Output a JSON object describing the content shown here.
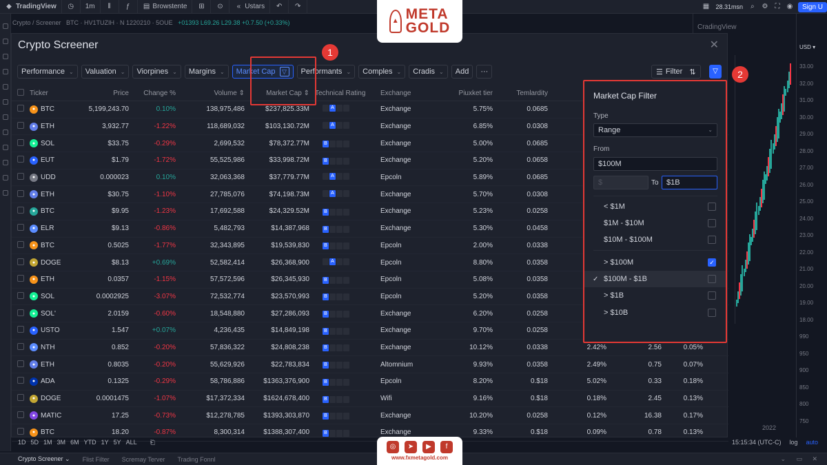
{
  "topbar": {
    "brand": "TradingView",
    "interval": "1m",
    "layout": "Browstente",
    "alerts": "Ustars",
    "price": "28.31msn",
    "signup": "Sign U"
  },
  "breadcrumb": {
    "path": "Crypto / Screener",
    "symbol": "BTC · HV1TUZIH · N 1220210 · 5OUE",
    "quote": "+01393 L69.26 L29.38 +0.7.50 (+0.33%)"
  },
  "modal": {
    "title": "Crypto Screener",
    "filter_tabs": [
      "Performance",
      "Valuation",
      "Viorpines",
      "Margins"
    ],
    "active_filter": "Market Cap",
    "more_tabs": [
      "Performants",
      "Comples",
      "Cradis"
    ],
    "add_label": "Add",
    "more_label": "···",
    "filter_label": "Filter"
  },
  "table": {
    "columns": [
      "Ticker",
      "Price",
      "Change %",
      "Volume ⇕",
      "Market Cap ⇕",
      "Technical Rating",
      "Exchange",
      "Piuxket tier",
      "Temlardity",
      "Bierleaf",
      "",
      ""
    ],
    "rows": [
      {
        "ticker": "BTC",
        "price": "5,199,243.70",
        "change": "0.10%",
        "dir": "pos",
        "volume": "138,975,486",
        "mcap": "$237,825.33M",
        "rating": "A",
        "exchange": "Exchange",
        "tier": "5.75%",
        "tem": "0.0685",
        "b1": "",
        "b2": "",
        "b3": "",
        "color": "#f7931a"
      },
      {
        "ticker": "ETH",
        "price": "3,932.77",
        "change": "-1.22%",
        "dir": "neg",
        "volume": "118,689,032",
        "mcap": "$103,130.72M",
        "rating": "A",
        "exchange": "Exchange",
        "tier": "6.85%",
        "tem": "0.0308",
        "b1": "",
        "b2": "",
        "b3": "",
        "color": "#627eea"
      },
      {
        "ticker": "SOL",
        "price": "$33.75",
        "change": "-0.29%",
        "dir": "neg",
        "volume": "2,699,532",
        "mcap": "$78,372.77M",
        "rating": "B",
        "exchange": "Exchange",
        "tier": "5.00%",
        "tem": "0.0685",
        "b1": "",
        "b2": "",
        "b3": "",
        "color": "#14f195"
      },
      {
        "ticker": "EUT",
        "price": "$1.79",
        "change": "-1.72%",
        "dir": "neg",
        "volume": "55,525,986",
        "mcap": "$33,998.72M",
        "rating": "B",
        "exchange": "Exchange",
        "tier": "5.20%",
        "tem": "0.0658",
        "b1": "",
        "b2": "",
        "b3": "",
        "color": "#2962ff"
      },
      {
        "ticker": "UDD",
        "price": "0.000023",
        "change": "0.10%",
        "dir": "pos",
        "volume": "32,063,368",
        "mcap": "$37,779.77M",
        "rating": "A",
        "exchange": "Epcoln",
        "tier": "5.89%",
        "tem": "0.0685",
        "b1": "",
        "b2": "",
        "b3": "",
        "color": "#787b86"
      },
      {
        "ticker": "ETH",
        "price": "$30.75",
        "change": "-1.10%",
        "dir": "neg",
        "volume": "27,785,076",
        "mcap": "$74,198.73M",
        "rating": "A",
        "exchange": "Exchange",
        "tier": "5.70%",
        "tem": "0.0308",
        "b1": "",
        "b2": "",
        "b3": "",
        "color": "#627eea"
      },
      {
        "ticker": "BTC",
        "price": "$9.95",
        "change": "-1.23%",
        "dir": "neg",
        "volume": "17,692,588",
        "mcap": "$24,329.52M",
        "rating": "B",
        "exchange": "Exchange",
        "tier": "5.23%",
        "tem": "0.0258",
        "b1": "",
        "b2": "",
        "b3": "",
        "color": "#26a69a"
      },
      {
        "ticker": "ELR",
        "price": "$9.13",
        "change": "-0.86%",
        "dir": "neg",
        "volume": "5,482,793",
        "mcap": "$14,387,968",
        "rating": "B",
        "exchange": "Exchange",
        "tier": "5.30%",
        "tem": "0.0458",
        "b1": "",
        "b2": "",
        "b3": "",
        "color": "#5b8cff"
      },
      {
        "ticker": "BTC",
        "price": "0.5025",
        "change": "-1.77%",
        "dir": "neg",
        "volume": "32,343,895",
        "mcap": "$19,539,830",
        "rating": "B",
        "exchange": "Epcoln",
        "tier": "2.00%",
        "tem": "0.0338",
        "b1": "",
        "b2": "",
        "b3": "",
        "color": "#f7931a"
      },
      {
        "ticker": "DOGE",
        "price": "$8.13",
        "change": "+0.69%",
        "dir": "pos",
        "volume": "52,582,414",
        "mcap": "$26,368,900",
        "rating": "A",
        "exchange": "Epcoln",
        "tier": "8.80%",
        "tem": "0.0358",
        "b1": "",
        "b2": "",
        "b3": "",
        "color": "#c2a633"
      },
      {
        "ticker": "ETH",
        "price": "0.0357",
        "change": "-1.15%",
        "dir": "neg",
        "volume": "57,572,596",
        "mcap": "$26,345,930",
        "rating": "B",
        "exchange": "Epcoln",
        "tier": "5.08%",
        "tem": "0.0358",
        "b1": "",
        "b2": "",
        "b3": "",
        "color": "#f7931a"
      },
      {
        "ticker": "SOL",
        "price": "0.0002925",
        "change": "-3.07%",
        "dir": "neg",
        "volume": "72,532,774",
        "mcap": "$23,570,993",
        "rating": "B",
        "exchange": "Epcoln",
        "tier": "5.20%",
        "tem": "0.0358",
        "b1": "",
        "b2": "",
        "b3": "",
        "color": "#14f195"
      },
      {
        "ticker": "SOL'",
        "price": "2.0159",
        "change": "-0.60%",
        "dir": "neg",
        "volume": "18,548,880",
        "mcap": "$27,286,093",
        "rating": "B",
        "exchange": "Exchange",
        "tier": "6.20%",
        "tem": "0.0258",
        "b1": "",
        "b2": "",
        "b3": "",
        "color": "#14f195"
      },
      {
        "ticker": "USTO",
        "price": "1.547",
        "change": "+0.07%",
        "dir": "pos",
        "volume": "4,236,435",
        "mcap": "$14,849,198",
        "rating": "B",
        "exchange": "Exchange",
        "tier": "9.70%",
        "tem": "0.0258",
        "b1": "",
        "b2": "",
        "b3": "",
        "color": "#2962ff"
      },
      {
        "ticker": "NTH",
        "price": "0.852",
        "change": "-0.20%",
        "dir": "neg",
        "volume": "57,836,322",
        "mcap": "$24,808,238",
        "rating": "B",
        "exchange": "Exchange",
        "tier": "10.12%",
        "tem": "0.0338",
        "b1": "2.42%",
        "b2": "2.56",
        "b3": "0.05%",
        "color": "#5b8cff"
      },
      {
        "ticker": "ETH",
        "price": "0.8035",
        "change": "-0.20%",
        "dir": "neg",
        "volume": "55,629,926",
        "mcap": "$22,783,834",
        "rating": "B",
        "exchange": "Altomnium",
        "tier": "9.93%",
        "tem": "0.0358",
        "b1": "2.49%",
        "b2": "0.75",
        "b3": "0.07%",
        "color": "#627eea"
      },
      {
        "ticker": "ADA",
        "price": "0.1325",
        "change": "-0.29%",
        "dir": "neg",
        "volume": "58,786,886",
        "mcap": "$1363,376,900",
        "rating": "B",
        "exchange": "Epcoln",
        "tier": "8.20%",
        "tem": "0.$18",
        "b1": "5.02%",
        "b2": "0.33",
        "b3": "0.18%",
        "color": "#0033ad"
      },
      {
        "ticker": "DOGE",
        "price": "0.0001475",
        "change": "-1.07%",
        "dir": "neg",
        "volume": "$17,372,334",
        "mcap": "$1624,678,400",
        "rating": "B",
        "exchange": "Wifi",
        "tier": "9.16%",
        "tem": "0.$18",
        "b1": "0.18%",
        "b2": "2.45",
        "b3": "0.13%",
        "color": "#c2a633"
      },
      {
        "ticker": "MATIC",
        "price": "17.25",
        "change": "-0.73%",
        "dir": "neg",
        "volume": "$12,278,785",
        "mcap": "$1393,303,870",
        "rating": "B",
        "exchange": "Exchange",
        "tier": "10.20%",
        "tem": "0.0258",
        "b1": "0.12%",
        "b2": "16.38",
        "b3": "0.17%",
        "color": "#8247e5"
      },
      {
        "ticker": "BTC",
        "price": "18.20",
        "change": "-0.87%",
        "dir": "neg",
        "volume": "8,300,314",
        "mcap": "$1388,307,400",
        "rating": "B",
        "exchange": "Exchange",
        "tier": "9.33%",
        "tem": "0.$18",
        "b1": "0.09%",
        "b2": "0.78",
        "b3": "0.13%",
        "color": "#f7931a"
      }
    ]
  },
  "popup": {
    "title": "Market Cap Filter",
    "type_label": "Type",
    "type_value": "Range",
    "from_label": "From",
    "from_value": "$100M",
    "min_placeholder": "$",
    "to_label": "To",
    "to_value": "$1B",
    "options": [
      {
        "label": "< $1M",
        "checked": false
      },
      {
        "label": "$1M - $10M",
        "checked": false
      },
      {
        "label": "$10M - $100M",
        "checked": false
      },
      {
        "label": "> $100M",
        "checked": true
      },
      {
        "label": "$100M - $1B",
        "checked": false,
        "selected": true
      },
      {
        "label": "> $1B",
        "checked": false
      },
      {
        "label": "> $10B",
        "checked": false
      }
    ]
  },
  "annotations": {
    "badge1": "1",
    "badge2": "2"
  },
  "chart": {
    "title": "CradingView",
    "currency": "USD ▾",
    "year": "2022",
    "axis_ticks": [
      "33.00",
      "32.00",
      "31.00",
      "30.00",
      "29.00",
      "28.00",
      "27.00",
      "26.00",
      "25.00",
      "24.00",
      "23.00",
      "22.00",
      "21.00",
      "20.00",
      "19.00",
      "18.00",
      "990",
      "950",
      "900",
      "850",
      "800",
      "750"
    ]
  },
  "logo": {
    "line1": "META",
    "line2": "GOLD"
  },
  "social": {
    "url": "www.fxmetagold.com"
  },
  "ranges": [
    "1D",
    "5D",
    "1M",
    "3M",
    "6M",
    "YTD",
    "1Y",
    "5Y",
    "ALL"
  ],
  "status": {
    "time": "15:15:34 (UTC-C)",
    "log": "log",
    "auto": "auto"
  },
  "bottom_tabs": [
    "Crypto Screener ⌄",
    "Flist Filter",
    "Scremay Terver",
    "Trading Fonnl"
  ]
}
